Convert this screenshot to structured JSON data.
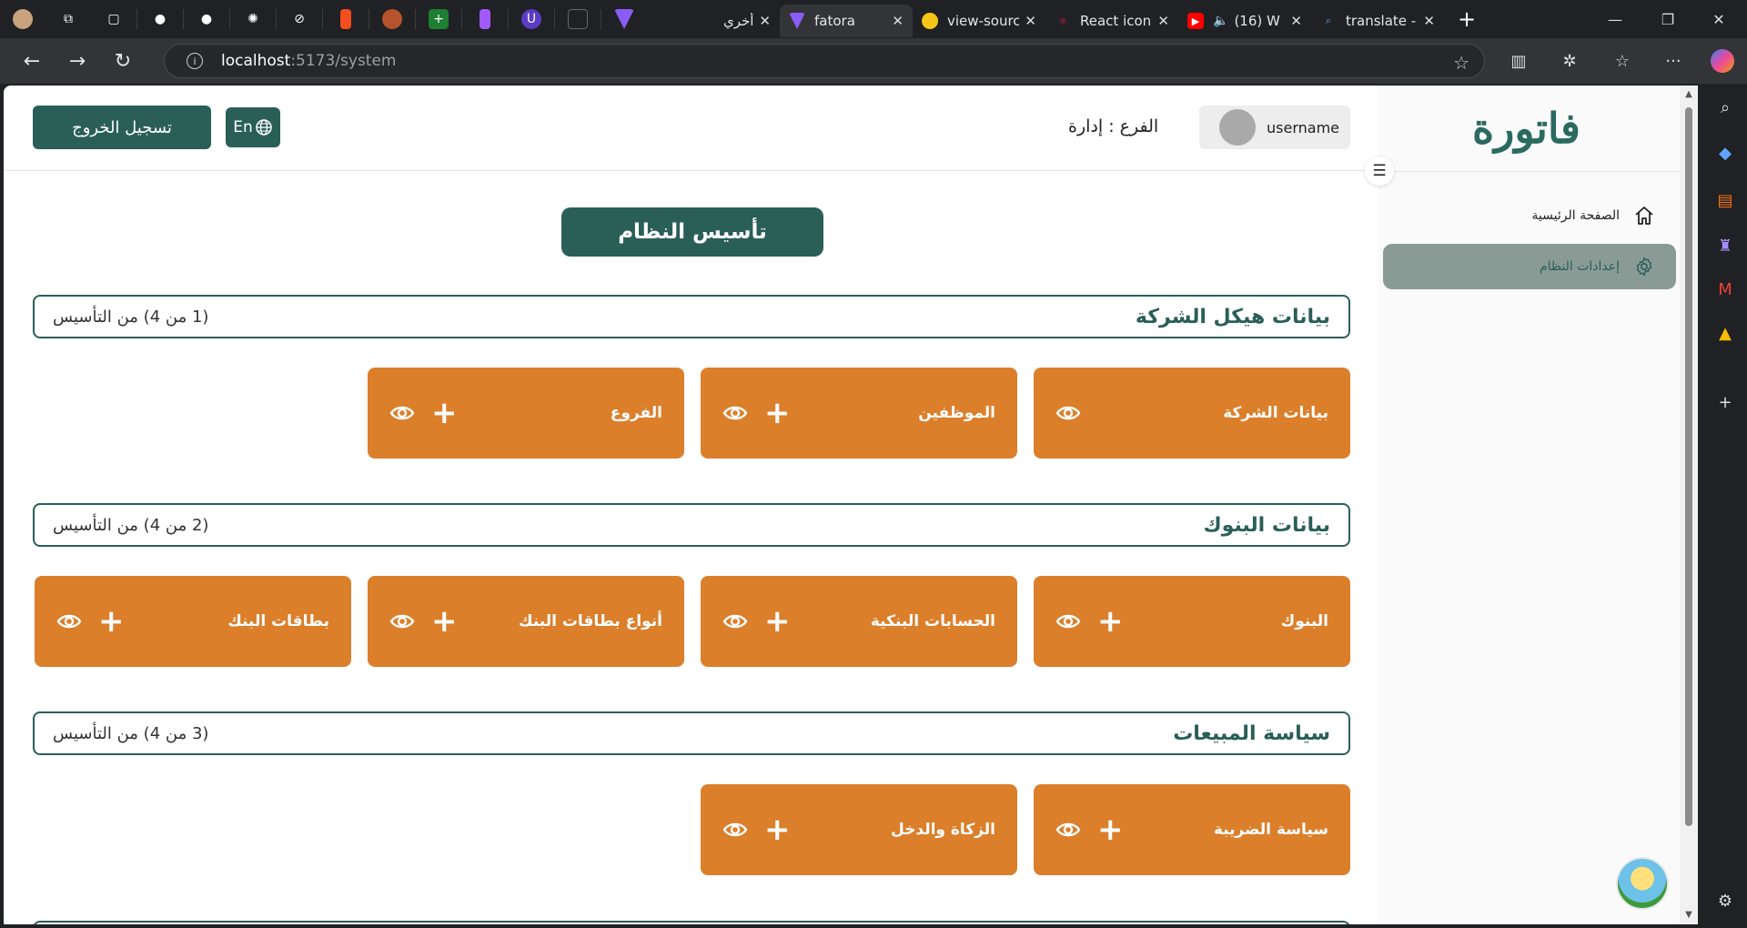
{
  "browser": {
    "tabs": [
      {
        "title": "أخري",
        "fav_color": "#7c3aed"
      },
      {
        "title": "fatora",
        "fav_color": "#8b5cf6"
      },
      {
        "title": "view-sourc",
        "fav_color": "#f5c518"
      },
      {
        "title": "React icon",
        "fav_color": "#e11d48"
      },
      {
        "title": "(16) W",
        "fav_color": "#ff0000"
      },
      {
        "title": "translate -",
        "fav_color": "#3b82f6"
      }
    ],
    "url_host": "localhost",
    "url_path": ":5173/system",
    "win_min": "—",
    "win_max": "❐",
    "win_close": "✕"
  },
  "app": {
    "logo": "فاتورة",
    "logout_label": "تسجيل الخروج",
    "lang_label": "En",
    "branch_label": "الفرع :",
    "branch_value": "إدارة",
    "username": "username",
    "page_title": "تأسيس النظام",
    "accent": "#2a5f58",
    "card_color": "#db7f2b"
  },
  "sidebar": {
    "items": [
      {
        "label": "الصفحة الرئيسية",
        "icon": "home-icon"
      },
      {
        "label": "إعدادات النظام",
        "icon": "gear-icon"
      }
    ]
  },
  "sections": [
    {
      "title": "بيانات هيكل الشركة",
      "step": "(1 من 4) من التأسيس",
      "cards": [
        {
          "label": "بيانات الشركة",
          "has_add": false
        },
        {
          "label": "الموظفين",
          "has_add": true
        },
        {
          "label": "الفروع",
          "has_add": true
        }
      ]
    },
    {
      "title": "بيانات البنوك",
      "step": "(2 من 4) من التأسيس",
      "cards": [
        {
          "label": "البنوك",
          "has_add": true
        },
        {
          "label": "الحسابات البنكية",
          "has_add": true
        },
        {
          "label": "أنواع بطاقات البنك",
          "has_add": true
        },
        {
          "label": "بطاقات البنك",
          "has_add": true
        }
      ]
    },
    {
      "title": "سياسة المبيعات",
      "step": "(3 من 4) من التأسيس",
      "cards": [
        {
          "label": "سياسة الضريبة",
          "has_add": true
        },
        {
          "label": "الزكاة والدخل",
          "has_add": true
        }
      ]
    }
  ]
}
